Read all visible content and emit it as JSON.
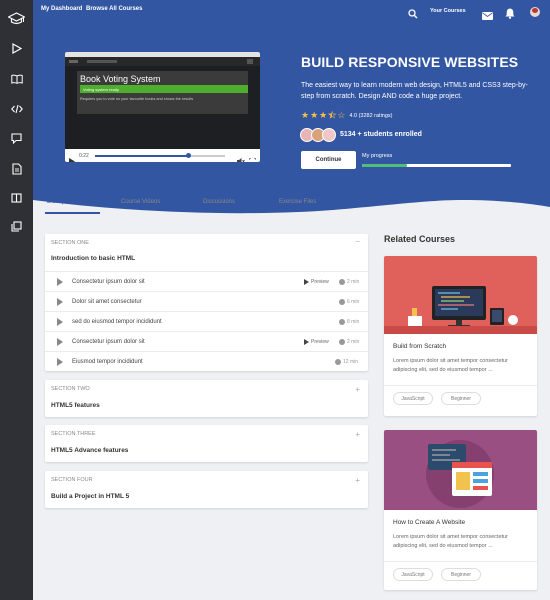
{
  "nav": {
    "dashboard": "My Dashboard",
    "browse": "Browse All Courses",
    "your_courses": "Your Courses"
  },
  "sidebar": {
    "icons": [
      "graduation-cap-icon",
      "play-icon",
      "book-icon",
      "code-icon",
      "comment-icon",
      "document-icon",
      "columns-icon",
      "copy-icon"
    ]
  },
  "video": {
    "slide_title": "Book Voting System",
    "slide_bar": "Voting system ready",
    "slide_text": "Requires you to vote on your favourite books and shows the results",
    "time": "0:22",
    "progress": 0.72
  },
  "course": {
    "title": "BUILD RESPONSIVE WEBSITES",
    "description": "The easiest way to learn modern web design, HTML5 and CSS3 step-by-step from scratch. Design AND code a huge project.",
    "rating": 3.5,
    "rating_text": "4.0 (3282 ratings)",
    "enrolled": "5134 + students enrolled",
    "continue_label": "Continue",
    "progress_label": "My progress",
    "progress": 0.3
  },
  "tabs": [
    "Discription",
    "Course Videos",
    "Discussions",
    "Exercise Files"
  ],
  "sections": [
    {
      "label": "SECTION ONE",
      "title": "Introduction to basic HTML",
      "toggle": "−",
      "lessons": [
        {
          "title": "Consectetur ipsum dolor sit",
          "preview": "Preview",
          "duration": "2 min"
        },
        {
          "title": "Dolor sit amet consectetur",
          "preview": "",
          "duration": "6 min"
        },
        {
          "title": "sed do eiusmod tempor incididunt",
          "preview": "",
          "duration": "8 min"
        },
        {
          "title": "Consectetur ipsum dolor sit",
          "preview": "Preview",
          "duration": "2 min"
        },
        {
          "title": "Eiusmod tempor incididunt",
          "preview": "",
          "duration": "12 min"
        }
      ]
    },
    {
      "label": "SECTION TWO",
      "title": "HTML5 features",
      "toggle": "+"
    },
    {
      "label": "SECTION THREE",
      "title": "HTML5 Advance features",
      "toggle": "+"
    },
    {
      "label": "SECTION FOUR",
      "title": "Build a Project in HTML 5",
      "toggle": "+"
    }
  ],
  "related": {
    "heading": "Related Courses",
    "courses": [
      {
        "title": "Build from Scratch",
        "desc": "Lorem ipsum dolor sit amet tempor consectetur adipiscing elit, sed do eiusmod tempor ...",
        "tags": [
          "JavaScript",
          "Beginner"
        ],
        "color": "#e0605c"
      },
      {
        "title": "How to Create A Website",
        "desc": "Lorem ipsum dolor sit amet tempor consectetur adipiscing elit, sed do eiusmod tempor ...",
        "tags": [
          "JavaScript",
          "Beginner"
        ],
        "color": "#9a4f83"
      }
    ]
  },
  "colors": {
    "brand": "#3356a3",
    "sidebar": "#2e3035",
    "progress": "#4fbf7a",
    "star": "#f6c146"
  }
}
